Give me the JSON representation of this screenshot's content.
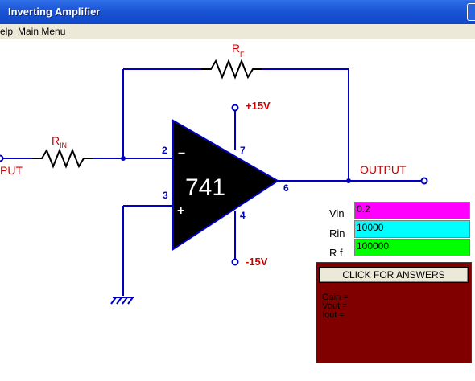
{
  "window": {
    "title": "Inverting Amplifier"
  },
  "menu": {
    "items": [
      "elp",
      "Main Menu"
    ]
  },
  "circuit": {
    "rf_label": "R",
    "rf_sub": "F",
    "rin_label": "R",
    "rin_sub": "IN",
    "input_label": "PUT",
    "output_label": "OUTPUT",
    "opamp_label": "741",
    "minus_sign": "−",
    "plus_sign": "+",
    "pin2": "2",
    "pin3": "3",
    "pin4": "4",
    "pin6": "6",
    "pin7": "7",
    "vplus": "+15V",
    "vminus": "-15V",
    "wire_color": "#0000c0",
    "label_color": "#cc0000"
  },
  "form": {
    "vin_label": "Vin",
    "vin_value": "0.2",
    "vin_color": "#ff00ff",
    "rin_label": "Rin",
    "rin_value": "10000",
    "rin_color": "#00ffff",
    "rf_label": "R f",
    "rf_value": "100000",
    "rf_color": "#00ff00"
  },
  "answers": {
    "button_label": "CLICK FOR ANSWERS",
    "gain_label": "Gain =",
    "vout_label": "Vout =",
    "iout_label": "Iout =",
    "panel_color": "#800000"
  }
}
